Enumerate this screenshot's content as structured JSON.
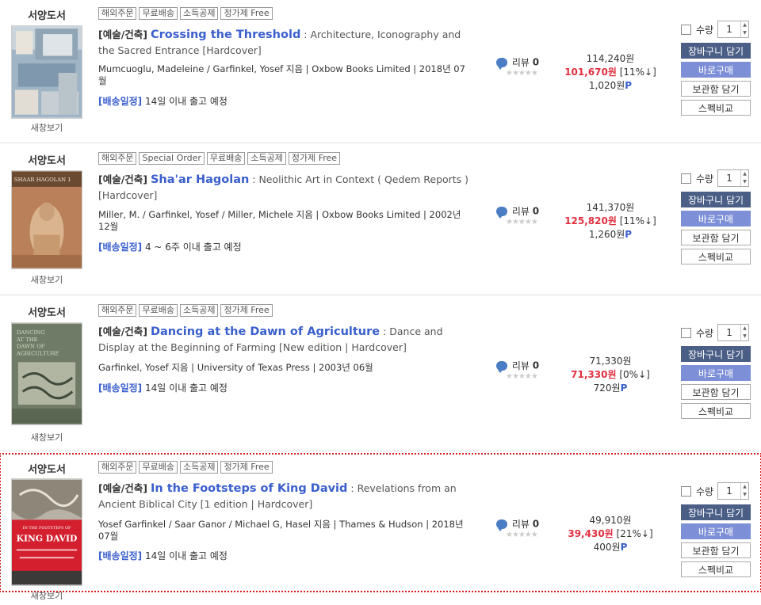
{
  "items": [
    {
      "category": "서양도서",
      "badges": [
        "해외주문",
        "무료배송",
        "소득공제",
        "정가제 Free"
      ],
      "genre": "[예술/건축]",
      "title": "Crossing the Threshold",
      "subtitle": " : Architecture, Iconography and the Sacred Entrance [Hardcover]",
      "authors": "Mumcuoglu, Madeleine / Garfinkel, Yosef 지음 | Oxbow Books Limited | 2018년 07월",
      "ship_label": "[배송일정]",
      "ship_text": " 14일 이내 출고 예정",
      "new_window": "새창보기",
      "review_label": "리뷰",
      "review_count": "0",
      "list_price": "114,240원",
      "sale_price": "101,670원",
      "discount": " [11%↓]",
      "points": "1,020원",
      "points_suffix": "P",
      "qty_label": "수량",
      "qty": "1",
      "btn_cart": "장바구니 담기",
      "btn_buy": "바로구매",
      "btn_keep": "보관함 담기",
      "btn_compare": "스펙비교"
    },
    {
      "category": "서양도서",
      "badges": [
        "해외주문",
        "Special Order",
        "무료배송",
        "소득공제",
        "정가제 Free"
      ],
      "genre": "[예술/건축]",
      "title": "Sha'ar Hagolan",
      "subtitle": " : Neolithic Art in Context ( Qedem Reports ) [Hardcover]",
      "authors": "Miller, M. / Garfinkel, Yosef / Miller, Michele 지음 | Oxbow Books Limited | 2002년 12월",
      "ship_label": "[배송일정]",
      "ship_text": " 4 ~ 6주 이내 출고 예정",
      "new_window": "새창보기",
      "review_label": "리뷰",
      "review_count": "0",
      "list_price": "141,370원",
      "sale_price": "125,820원",
      "discount": " [11%↓]",
      "points": "1,260원",
      "points_suffix": "P",
      "qty_label": "수량",
      "qty": "1",
      "btn_cart": "장바구니 담기",
      "btn_buy": "바로구매",
      "btn_keep": "보관함 담기",
      "btn_compare": "스펙비교"
    },
    {
      "category": "서양도서",
      "badges": [
        "해외주문",
        "무료배송",
        "소득공제",
        "정가제 Free"
      ],
      "genre": "[예술/건축]",
      "title": "Dancing at the Dawn of Agriculture",
      "subtitle": " : Dance and Display at the Beginning of Farming [New edition | Hardcover]",
      "authors": "Garfinkel, Yosef 지음 | University of Texas Press | 2003년 06월",
      "ship_label": "[배송일정]",
      "ship_text": " 14일 이내 출고 예정",
      "new_window": "새창보기",
      "review_label": "리뷰",
      "review_count": "0",
      "list_price": "71,330원",
      "sale_price": "71,330원",
      "discount": " [0%↓]",
      "points": "720원",
      "points_suffix": "P",
      "qty_label": "수량",
      "qty": "1",
      "btn_cart": "장바구니 담기",
      "btn_buy": "바로구매",
      "btn_keep": "보관함 담기",
      "btn_compare": "스펙비교"
    },
    {
      "category": "서양도서",
      "badges": [
        "해외주문",
        "무료배송",
        "소득공제",
        "정가제 Free"
      ],
      "genre": "[예술/건축]",
      "title": "In the Footsteps of King David",
      "subtitle": " : Revelations from an Ancient Biblical City [1 edition | Hardcover]",
      "authors": "Yosef Garfinkel / Saar Ganor / Michael G, Hasel 지음 | Thames & Hudson | 2018년 07월",
      "ship_label": "[배송일정]",
      "ship_text": " 14일 이내 출고 예정",
      "new_window": "새창보기",
      "review_label": "리뷰",
      "review_count": "0",
      "list_price": "49,910원",
      "sale_price": "39,430원",
      "discount": " [21%↓]",
      "points": "400원",
      "points_suffix": "P",
      "qty_label": "수량",
      "qty": "1",
      "btn_cart": "장바구니 담기",
      "btn_buy": "바로구매",
      "btn_keep": "보관함 담기",
      "btn_compare": "스펙비교",
      "cover_text_1": "IN THE FOOTSTEPS OF",
      "cover_text_2": "KING DAVID"
    }
  ],
  "colors": {
    "link": "#3a5fcd",
    "sale": "#e03040",
    "cart_button": "#4a5e86",
    "buy_button": "#7d8fd6",
    "highlight_border": "#d11a1a"
  },
  "stars": "★★★★★"
}
